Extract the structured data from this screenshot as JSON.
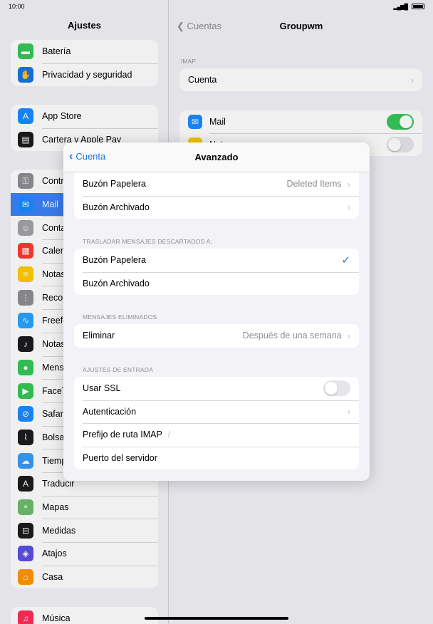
{
  "status": {
    "time": "10:00"
  },
  "sidebar": {
    "title": "Ajustes",
    "group1": [
      {
        "label": "Batería",
        "icon": "battery-icon",
        "color": "#34c759",
        "glyph": "▬"
      },
      {
        "label": "Privacidad y seguridad",
        "icon": "hand-icon",
        "color": "#1a73e8",
        "glyph": "✋"
      }
    ],
    "group2": [
      {
        "label": "App Store",
        "icon": "app-store-icon",
        "color": "#1a8cff",
        "glyph": "A"
      },
      {
        "label": "Cartera y Apple Pay",
        "icon": "wallet-icon",
        "color": "#1c1c1e",
        "glyph": "▤"
      }
    ],
    "group3": [
      {
        "label": "Contraseñas",
        "icon": "key-icon",
        "color": "#8e8e93",
        "glyph": "⚿"
      },
      {
        "label": "Mail",
        "icon": "mail-icon",
        "color": "#1a8cff",
        "glyph": "✉"
      },
      {
        "label": "Contactos",
        "icon": "contacts-icon",
        "color": "#a2a2a7",
        "glyph": "☺"
      },
      {
        "label": "Calendario",
        "icon": "calendar-icon",
        "color": "#ff3b30",
        "glyph": "▦"
      },
      {
        "label": "Notas",
        "icon": "notes-icon",
        "color": "#ffcc00",
        "glyph": "≡"
      },
      {
        "label": "Recordatorios",
        "icon": "reminders-icon",
        "color": "#8e8e93",
        "glyph": "⋮"
      },
      {
        "label": "Freeform",
        "icon": "freeform-icon",
        "color": "#29a3ff",
        "glyph": "∿"
      },
      {
        "label": "Notas de voz",
        "icon": "voice-memos-icon",
        "color": "#1c1c1e",
        "glyph": "♪"
      },
      {
        "label": "Mensajes",
        "icon": "messages-icon",
        "color": "#34c759",
        "glyph": "●"
      },
      {
        "label": "FaceTime",
        "icon": "facetime-icon",
        "color": "#34c759",
        "glyph": "▶"
      },
      {
        "label": "Safari",
        "icon": "safari-icon",
        "color": "#1a8cff",
        "glyph": "⊘"
      },
      {
        "label": "Bolsa",
        "icon": "stocks-icon",
        "color": "#1c1c1e",
        "glyph": "⌇"
      },
      {
        "label": "Tiempo",
        "icon": "weather-icon",
        "color": "#3a9cf5",
        "glyph": "☁"
      },
      {
        "label": "Traducir",
        "icon": "translate-icon",
        "color": "#1c1c1e",
        "glyph": "A"
      },
      {
        "label": "Mapas",
        "icon": "maps-icon",
        "color": "#6dbd6d",
        "glyph": "⌖"
      },
      {
        "label": "Medidas",
        "icon": "measure-icon",
        "color": "#1c1c1e",
        "glyph": "⊟"
      },
      {
        "label": "Atajos",
        "icon": "shortcuts-icon",
        "color": "#5b4fe0",
        "glyph": "◈"
      },
      {
        "label": "Casa",
        "icon": "home-icon",
        "color": "#ff9500",
        "glyph": "⌂"
      }
    ],
    "group4": [
      {
        "label": "Música",
        "icon": "music-icon",
        "color": "#ff2d55",
        "glyph": "♫"
      }
    ]
  },
  "detail": {
    "back": "Cuentas",
    "title": "Groupwm",
    "imap_header": "IMAP",
    "account_label": "Cuenta",
    "mail_label": "Mail",
    "notes_label": "Notas"
  },
  "modal": {
    "back": "Cuenta",
    "title": "Avanzado",
    "top_rows": [
      {
        "label": "Buzón Papelera",
        "value": "Deleted Items"
      },
      {
        "label": "Buzón Archivado",
        "value": ""
      }
    ],
    "move_header": "TRASLADAR MENSAJES DESCARTADOS A:",
    "move_rows": [
      {
        "label": "Buzón Papelera",
        "checked": true,
        "check": "✓"
      },
      {
        "label": "Buzón Archivado",
        "checked": false,
        "check": ""
      }
    ],
    "deleted_header": "MENSAJES ELIMINADOS",
    "delete_label": "Eliminar",
    "delete_value": "Después de una semana",
    "incoming_header": "AJUSTES DE ENTRADA",
    "ssl_label": "Usar SSL",
    "auth_label": "Autenticación",
    "prefix_label": "Prefijo de ruta IMAP",
    "prefix_value": "/",
    "port_label": "Puerto del servidor"
  }
}
